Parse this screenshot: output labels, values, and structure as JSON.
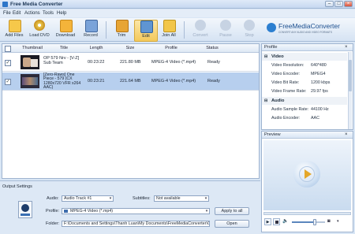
{
  "window": {
    "title": "Free Media Converter"
  },
  "menu": [
    "File",
    "Edit",
    "Actions",
    "Tools",
    "Help"
  ],
  "toolbar": {
    "add_files": "Add Files",
    "load_dvd": "Load DVD",
    "download": "Download",
    "record": "Record",
    "trim": "Trim",
    "edit": "Edit",
    "join_all": "Join All",
    "convert": "Convert",
    "pause": "Pause",
    "stop": "Stop"
  },
  "logo": {
    "name": "FreeMediaConverter",
    "tagline": "CONVERT ANY AUDIO AND VIDEO FORMATS"
  },
  "file_list": {
    "columns": {
      "thumbnail": "Thumbnail",
      "title": "Title",
      "length": "Length",
      "size": "Size",
      "profile": "Profile",
      "status": "Status"
    },
    "rows": [
      {
        "title_lines": [
          "OP 579 Nrv - [V-Z]",
          "Sub Team"
        ],
        "length": "00:23:22",
        "size": "221.80 MB",
        "profile": "MPEG-4 Video (*.mp4)",
        "status": "Ready",
        "checked": "✓"
      },
      {
        "title_lines": [
          "[Zero-Raws] One",
          "Piece - 579 (CX",
          "1280x720 VFR x264",
          "AAC)"
        ],
        "length": "00:23:21",
        "size": "221.64 MB",
        "profile": "MPEG-4 Video (*.mp4)",
        "status": "Ready",
        "checked": "✓"
      }
    ]
  },
  "profile_panel": {
    "title": "Profile",
    "video_group": "Video",
    "video": [
      {
        "k": "Video Resolution:",
        "v": "640*480"
      },
      {
        "k": "Video Encoder:",
        "v": "MPEG4"
      },
      {
        "k": "Video Bit Rate:",
        "v": "1200 kbps"
      },
      {
        "k": "Video Frame Rate:",
        "v": "29.97 fps"
      }
    ],
    "audio_group": "Audio",
    "audio": [
      {
        "k": "Audio Sample Rate:",
        "v": "44100 Hz"
      },
      {
        "k": "Audio Encoder:",
        "v": "AAC"
      }
    ]
  },
  "preview": {
    "title": "Preview",
    "volume_fraction": 0.7
  },
  "output_settings": {
    "title": "Output Settings",
    "audio_label": "Audio:",
    "audio_value": "Audio Track #1",
    "subtitles_label": "Subtitles:",
    "subtitles_value": "Not available",
    "profile_label": "Profile:",
    "profile_value": "MPEG-4 Video (*.mp4)",
    "apply_all": "Apply to all",
    "folder_label": "Folder:",
    "folder_value": "F:\\Documents and Settings\\Thanh Luan\\My Documents\\FreeMediaConverter\\O",
    "open": "Open"
  }
}
